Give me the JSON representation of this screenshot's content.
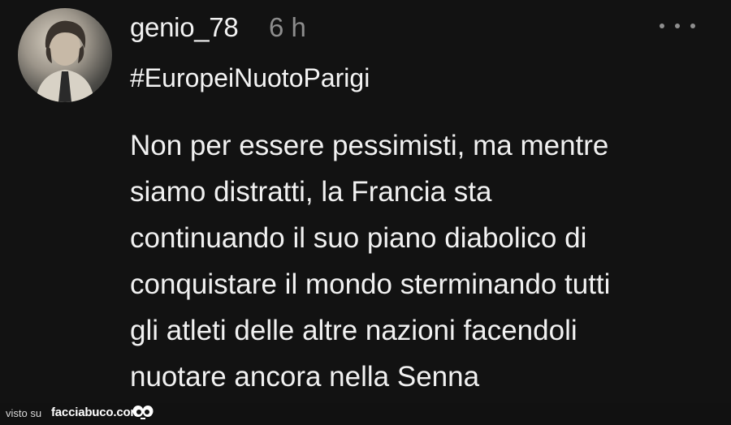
{
  "post": {
    "username": "genio_78",
    "time": "6 h",
    "hashtag": "#EuropeiNuotoParigi",
    "lines": [
      "Non per essere pessimisti, ma mentre",
      "siamo distratti, la Francia sta",
      "continuando il suo piano diabolico di",
      "conquistare il mondo sterminando tutti",
      "gli atleti delle altre nazioni facendoli",
      "nuotare ancora nella Senna"
    ],
    "avatar_icon": "profile-photo",
    "more_icon": "ellipsis-icon"
  },
  "footer": {
    "visto": "visto su",
    "brand": "facciabuco.com",
    "logo_icon": "eyes-icon"
  },
  "colors": {
    "background": "#121212",
    "text": "#f1f1f1",
    "muted": "#8d8d8d"
  }
}
